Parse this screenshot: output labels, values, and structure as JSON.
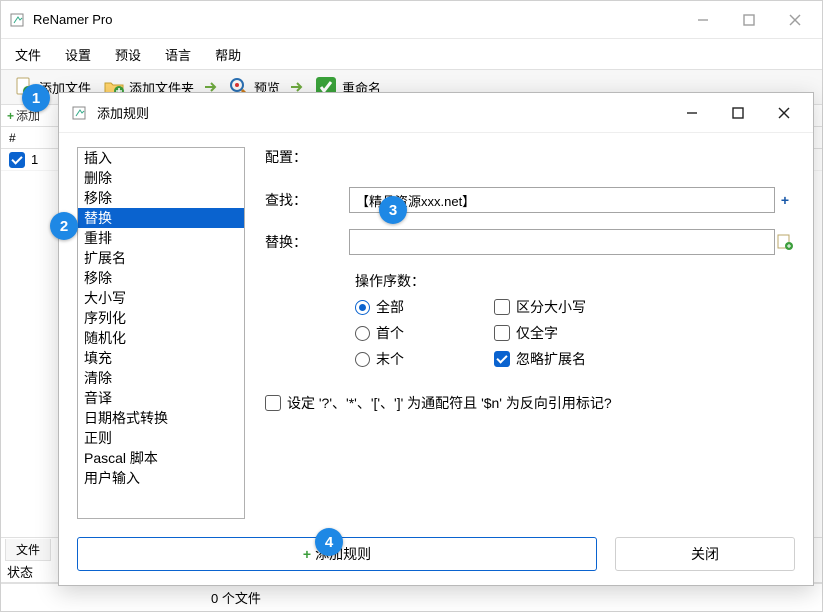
{
  "main": {
    "title": "ReNamer Pro",
    "menu": [
      "文件",
      "设置",
      "预设",
      "语言",
      "帮助"
    ],
    "toolbar": {
      "add_files": "添加文件",
      "add_folder": "添加文件夹",
      "preview": "预览",
      "rename": "重命名"
    },
    "sub_add": "添加",
    "hash_header": "#",
    "sample_row": {
      "checked": true,
      "index": "1"
    },
    "files_tab": "文件",
    "state_label": "状态",
    "status_files": "0 个文件"
  },
  "dialog": {
    "title": "添加规则",
    "rules": [
      "插入",
      "删除",
      "移除",
      "替换",
      "重排",
      "扩展名",
      "移除",
      "大小写",
      "序列化",
      "随机化",
      "填充",
      "清除",
      "音译",
      "日期格式转换",
      "正则",
      "Pascal 脚本",
      "用户输入"
    ],
    "selected_rule_index": 3,
    "config": {
      "header": "配置：",
      "find_label": "查找：",
      "find_value": "【精品资源xxx.net】",
      "replace_label": "替换：",
      "replace_value": "",
      "seq_label": "操作序数：",
      "seq_options": {
        "all": "全部",
        "first": "首个",
        "last": "末个"
      },
      "seq_selected": "all",
      "case_sensitive": {
        "label": "区分大小写",
        "checked": false
      },
      "whole_word": {
        "label": "仅全字",
        "checked": false
      },
      "skip_ext": {
        "label": "忽略扩展名",
        "checked": true
      },
      "wildcard": {
        "label": "设定 '?'、'*'、'['、']' 为通配符且 '$n' 为反向引用标记?",
        "checked": false
      }
    },
    "footer": {
      "add": "添加规则",
      "close": "关闭"
    }
  },
  "badges": {
    "1": "1",
    "2": "2",
    "3": "3",
    "4": "4"
  }
}
